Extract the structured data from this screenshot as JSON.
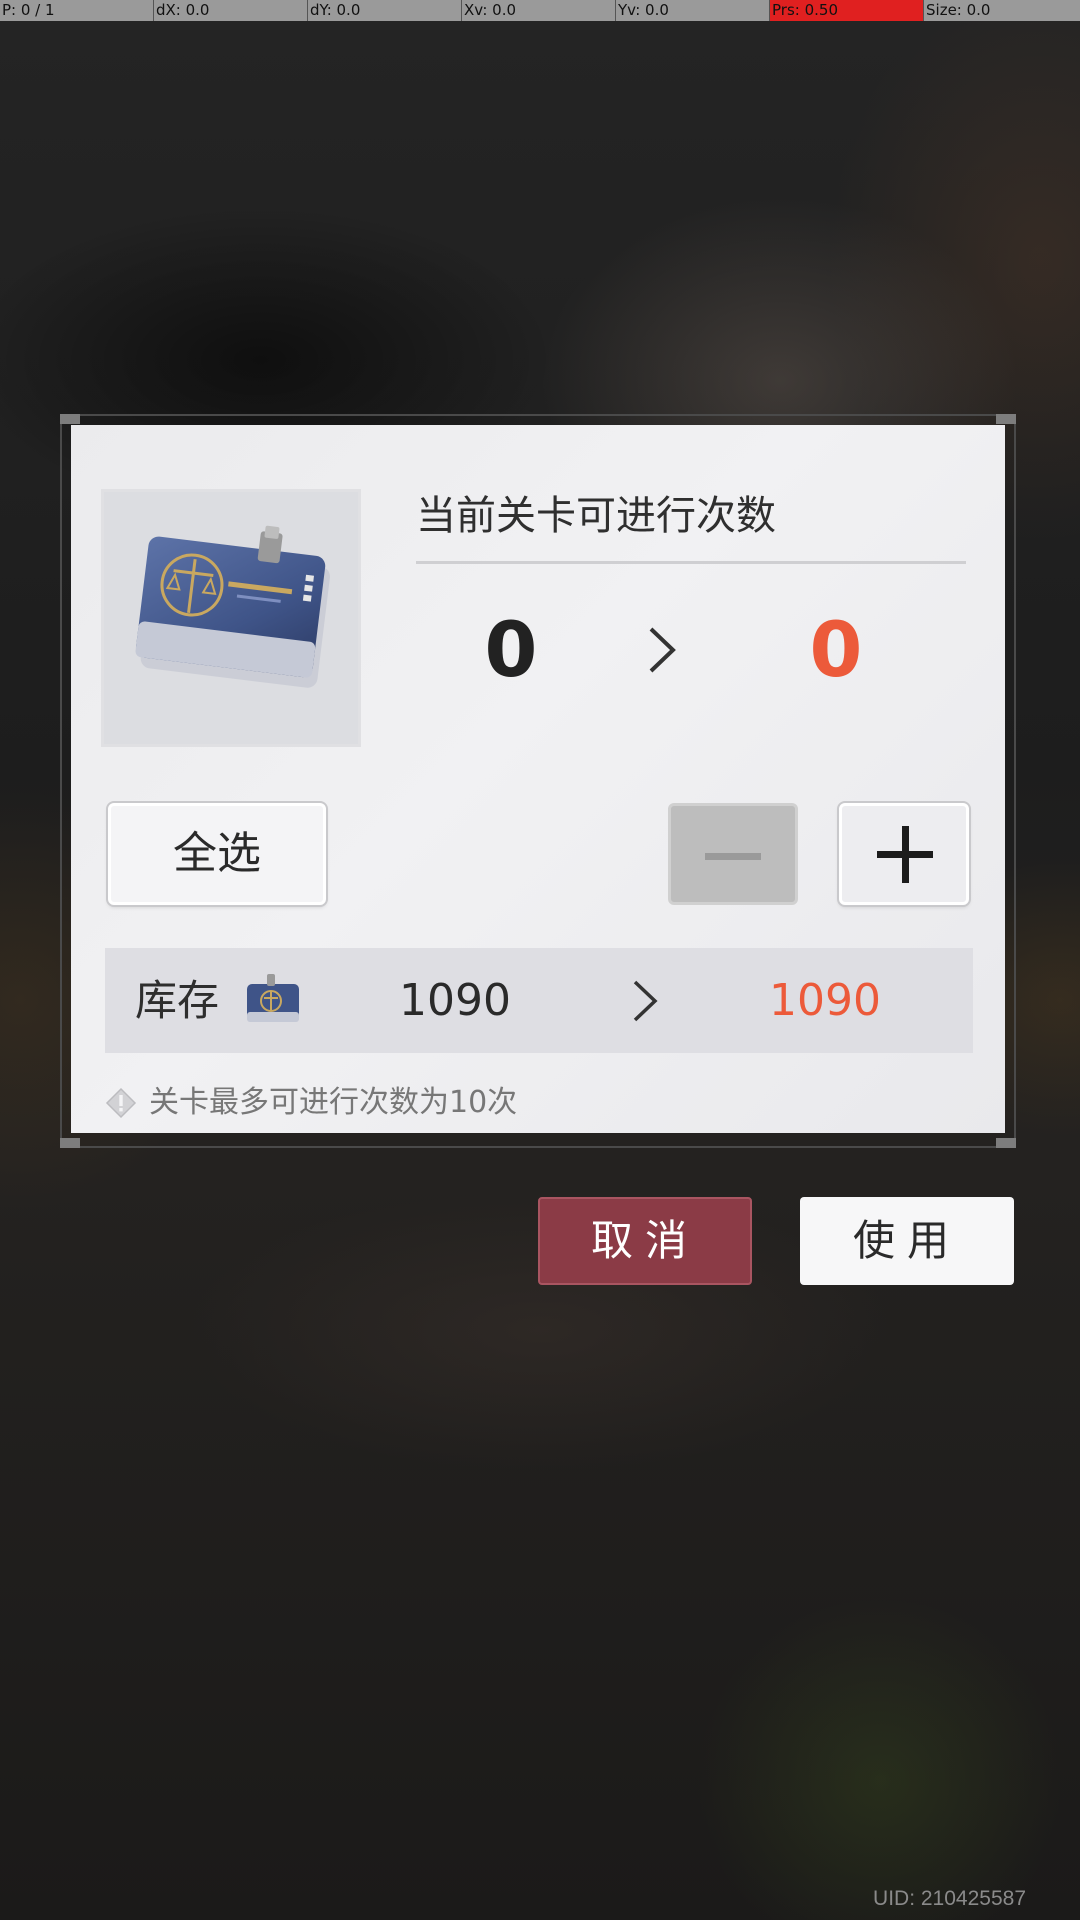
{
  "debug_bar": {
    "pointer": "P: 0 / 1",
    "dx": "dX: 0.0",
    "dy": "dY: 0.0",
    "xv": "Xv: 0.0",
    "yv": "Yv: 0.0",
    "prs": "Prs: 0.50",
    "size": "Size: 0.0",
    "highlight_color": "#e02020"
  },
  "dialog": {
    "item_icon": "law-firm-pass-card-icon",
    "title": "当前关卡可进行次数",
    "count_from": "0",
    "count_to": "0",
    "select_all_label": "全选",
    "minus_icon": "minus-icon",
    "plus_icon": "plus-icon",
    "stock": {
      "label": "库存",
      "icon": "pass-card-icon",
      "from": "1090",
      "to": "1090"
    },
    "hint_icon": "warning-diamond-icon",
    "hint": "关卡最多可进行次数为10次"
  },
  "actions": {
    "cancel_label": "取消",
    "use_label": "使用"
  },
  "uid": "UID: 210425587",
  "colors": {
    "accent_red": "#ec5a3a",
    "cancel_bg": "#8b3b46",
    "dialog_bg": "#ededf0"
  }
}
